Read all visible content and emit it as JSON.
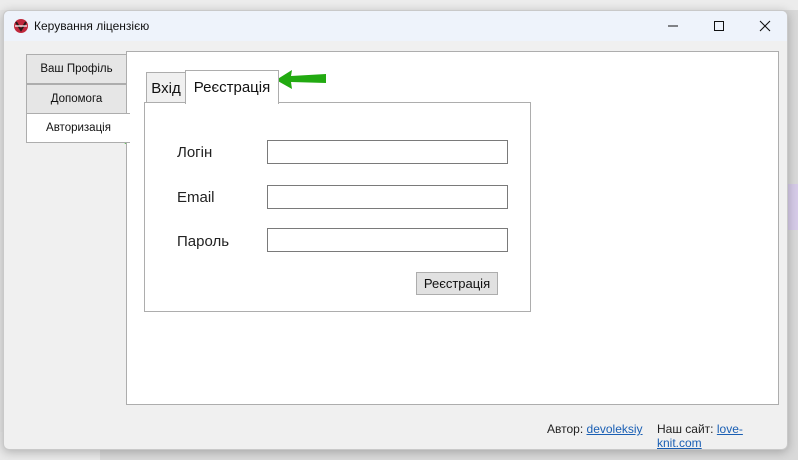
{
  "window": {
    "title": "Керування ліцензією",
    "controls": {
      "minimize": "—",
      "maximize": "☐",
      "close": "✕"
    }
  },
  "sidebar": {
    "tabs": [
      {
        "label": "Ваш Профіль",
        "active": false
      },
      {
        "label": "Допомога",
        "active": false
      },
      {
        "label": "Авторизація",
        "active": true
      }
    ]
  },
  "auth": {
    "tabs": [
      {
        "label": "Вхід",
        "active": false
      },
      {
        "label": "Реєстрація",
        "active": true
      }
    ],
    "form": {
      "login_label": "Логін",
      "login_value": "",
      "email_label": "Email",
      "email_value": "",
      "password_label": "Пароль",
      "password_value": "",
      "submit_label": "Реєстрація"
    }
  },
  "footer": {
    "author_label": "Автор:",
    "author_link": "devoleksiy",
    "site_label": "Наш сайт:",
    "site_link": "love-knit.com"
  },
  "colors": {
    "arrow": "#22aa11",
    "link": "#1a5fb4",
    "title_bar": "#eef3fb"
  }
}
